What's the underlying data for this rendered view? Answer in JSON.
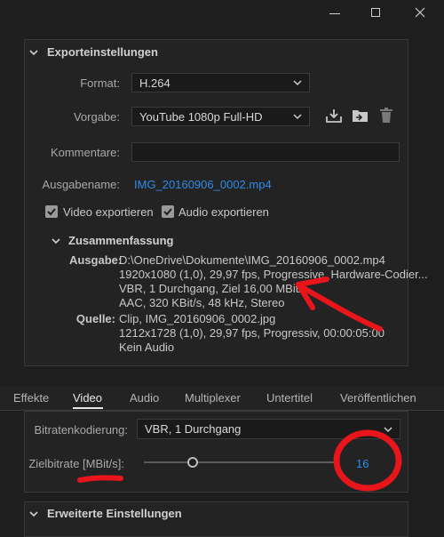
{
  "window": {
    "minimize_glyph": "—",
    "maximize_glyph": "☐",
    "close_glyph": "✕"
  },
  "export_settings": {
    "title": "Exporteinstellungen",
    "format_label": "Format:",
    "format_value": "H.264",
    "preset_label": "Vorgabe:",
    "preset_value": "YouTube 1080p Full-HD",
    "comments_label": "Kommentare:",
    "comments_value": "",
    "output_name_label": "Ausgabename:",
    "output_name_value": "IMG_20160906_0002.mp4",
    "export_video_label": "Video exportieren",
    "export_video_checked": true,
    "export_audio_label": "Audio exportieren",
    "export_audio_checked": true,
    "icons": [
      "save-preset-icon",
      "import-preset-icon",
      "delete-preset-icon"
    ]
  },
  "summary": {
    "title": "Zusammenfassung",
    "output_label": "Ausgabe:",
    "output_lines": [
      "D:\\OneDrive\\Dokumente\\IMG_20160906_0002.mp4",
      "1920x1080 (1,0), 29,97 fps, Progressive, Hardware-Codier...",
      "VBR, 1 Durchgang, Ziel 16,00 MBit/s",
      "AAC, 320 KBit/s, 48 kHz, Stereo"
    ],
    "source_label": "Quelle:",
    "source_lines": [
      "Clip, IMG_20160906_0002.jpg",
      "1212x1728 (1,0), 29,97 fps, Progressiv, 00:00:05:00",
      "Kein Audio"
    ]
  },
  "tabs": [
    {
      "label": "Effekte",
      "active": false
    },
    {
      "label": "Video",
      "active": true
    },
    {
      "label": "Audio",
      "active": false
    },
    {
      "label": "Multiplexer",
      "active": false
    },
    {
      "label": "Untertitel",
      "active": false
    },
    {
      "label": "Veröffentlichen",
      "active": false
    }
  ],
  "bitrate": {
    "encoding_label": "Bitratenkodierung:",
    "encoding_value": "VBR, 1 Durchgang",
    "target_label": "Zielbitrate [MBit/s]:",
    "target_value": "16",
    "target_fraction": 0.25
  },
  "advanced": {
    "title": "Erweiterte Einstellungen"
  },
  "colors": {
    "accent_blue": "#2d8ceb",
    "annotation_red": "#e8151b",
    "panel_bg": "#232323",
    "window_bg": "#1e1e1e"
  }
}
